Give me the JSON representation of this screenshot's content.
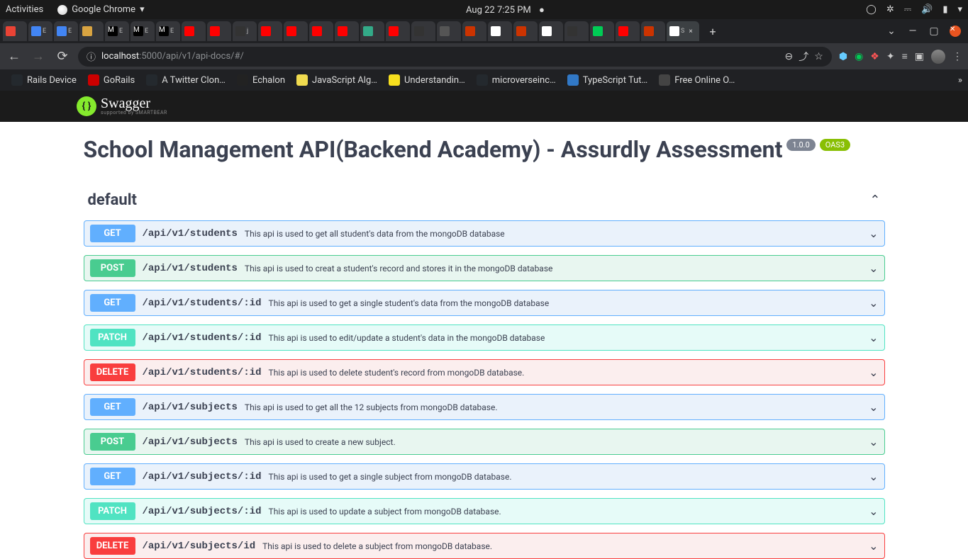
{
  "ubuntu": {
    "activities": "Activities",
    "app": "Google Chrome",
    "datetime": "Aug 22   7:25 PM"
  },
  "browser": {
    "url_host": "localhost",
    "url_path": ":5000/api/v1/api-docs/#/",
    "active_tab": "S"
  },
  "bookmarks": [
    {
      "label": "Rails Device",
      "fav": "#24292e"
    },
    {
      "label": "GoRails",
      "fav": "#cc0000"
    },
    {
      "label": "A Twitter Clon…",
      "fav": "#24292e"
    },
    {
      "label": "Echalon",
      "fav": "#222"
    },
    {
      "label": "JavaScript Alg…",
      "fav": "#f0db4f"
    },
    {
      "label": "Understandin…",
      "fav": "#f7df1e"
    },
    {
      "label": "microverseinc…",
      "fav": "#24292e"
    },
    {
      "label": "TypeScript Tut…",
      "fav": "#3178c6"
    },
    {
      "label": "Free Online O…",
      "fav": "#444"
    }
  ],
  "swagger": {
    "brand": "Swagger",
    "sub": "supported by SMARTBEAR",
    "title": "School Management API(Backend Academy) - Assurdly Assessment",
    "version": "1.0.0",
    "oas": "OAS3",
    "section": "default"
  },
  "ops": [
    {
      "method": "GET",
      "cls": "get",
      "path": "/api/v1/students",
      "desc": "This api is used to get all student's data from the mongoDB database"
    },
    {
      "method": "POST",
      "cls": "post",
      "path": "/api/v1/students",
      "desc": "This api is used to creat a student's record and stores it in the mongoDB database"
    },
    {
      "method": "GET",
      "cls": "get",
      "path": "/api/v1/students/:id",
      "desc": "This api is used to get a single student's data from the mongoDB database"
    },
    {
      "method": "PATCH",
      "cls": "patch",
      "path": "/api/v1/students/:id",
      "desc": "This api is used to edit/update a student's data in the mongoDB database"
    },
    {
      "method": "DELETE",
      "cls": "delete",
      "path": "/api/v1/students/:id",
      "desc": "This api is used to delete student's record from mongoDB database."
    },
    {
      "method": "GET",
      "cls": "get",
      "path": "/api/v1/subjects",
      "desc": "This api is used to get all the 12 subjects from mongoDB database."
    },
    {
      "method": "POST",
      "cls": "post",
      "path": "/api/v1/subjects",
      "desc": "This api is used to create a new subject."
    },
    {
      "method": "GET",
      "cls": "get",
      "path": "/api/v1/subjects/:id",
      "desc": "This api is used to get a single subject from mongoDB database."
    },
    {
      "method": "PATCH",
      "cls": "patch",
      "path": "/api/v1/subjects/:id",
      "desc": "This api is used to update a subject from mongoDB database."
    },
    {
      "method": "DELETE",
      "cls": "delete",
      "path": "/api/v1/subjects/id",
      "desc": "This api is used to delete a subject from mongoDB database."
    }
  ]
}
